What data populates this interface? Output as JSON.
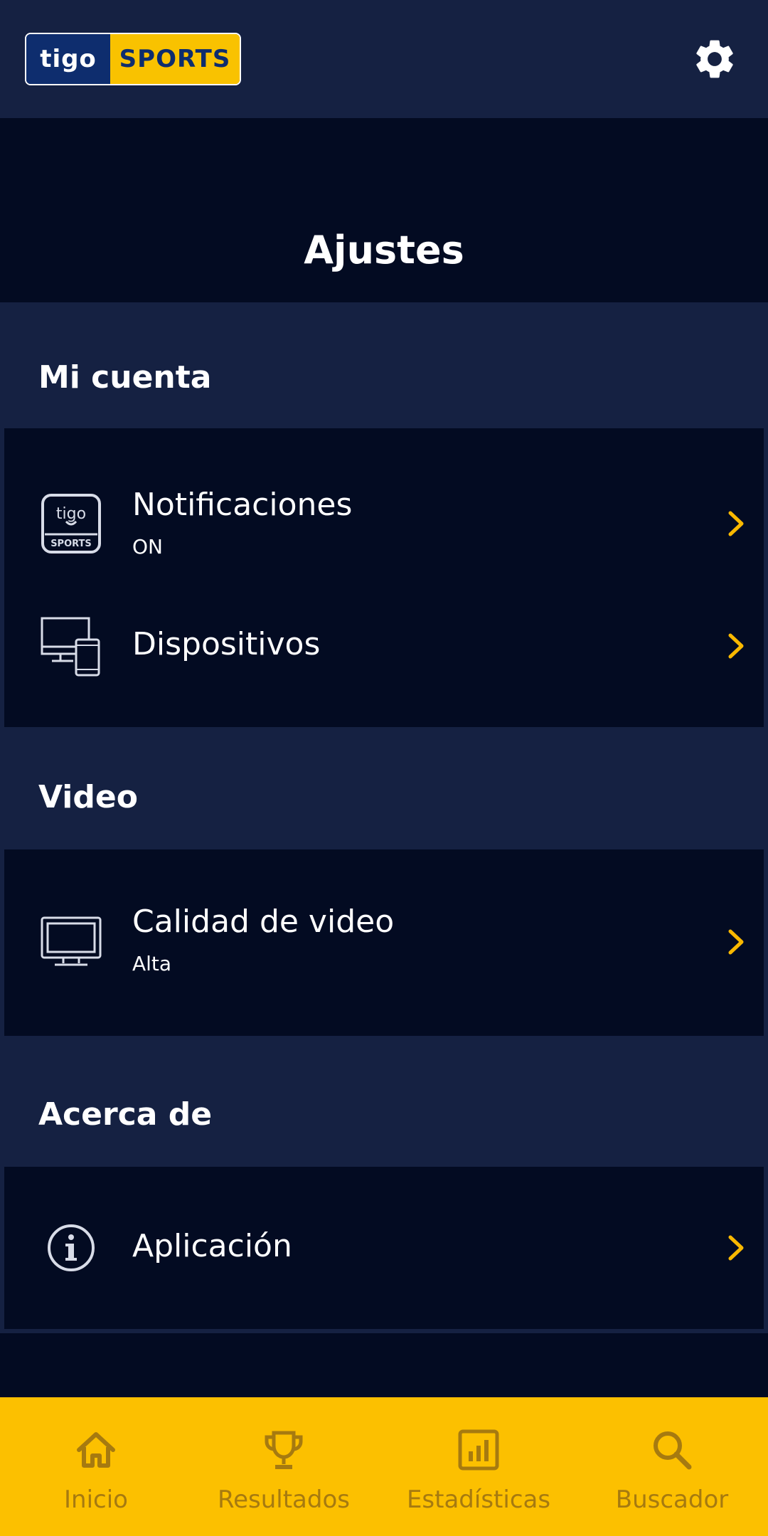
{
  "header": {
    "logo": {
      "left_text": "tigo",
      "right_text": "SPORTS"
    },
    "settings_icon": "gear-icon"
  },
  "page": {
    "title": "Ajustes"
  },
  "sections": {
    "account": {
      "header": "Mi cuenta",
      "items": [
        {
          "title": "Notificaciones",
          "subtitle": "ON",
          "icon": "tigo-sports-icon"
        },
        {
          "title": "Dispositivos",
          "icon": "devices-icon"
        }
      ]
    },
    "video": {
      "header": "Video",
      "items": [
        {
          "title": "Calidad de video",
          "subtitle": "Alta",
          "icon": "tv-icon"
        }
      ]
    },
    "about": {
      "header": "Acerca de",
      "items": [
        {
          "title": "Aplicación",
          "icon": "info-icon"
        }
      ]
    }
  },
  "bottom_nav": {
    "items": [
      {
        "label": "Inicio",
        "icon": "home-icon"
      },
      {
        "label": "Resultados",
        "icon": "trophy-icon"
      },
      {
        "label": "Estadísticas",
        "icon": "stats-icon"
      },
      {
        "label": "Buscador",
        "icon": "search-icon"
      }
    ]
  },
  "colors": {
    "background": "#152142",
    "card": "#030b22",
    "accent": "#fcc000",
    "chevron": "#f9b800",
    "nav_label": "#a67a10",
    "logo_blue": "#0e2d6e"
  }
}
